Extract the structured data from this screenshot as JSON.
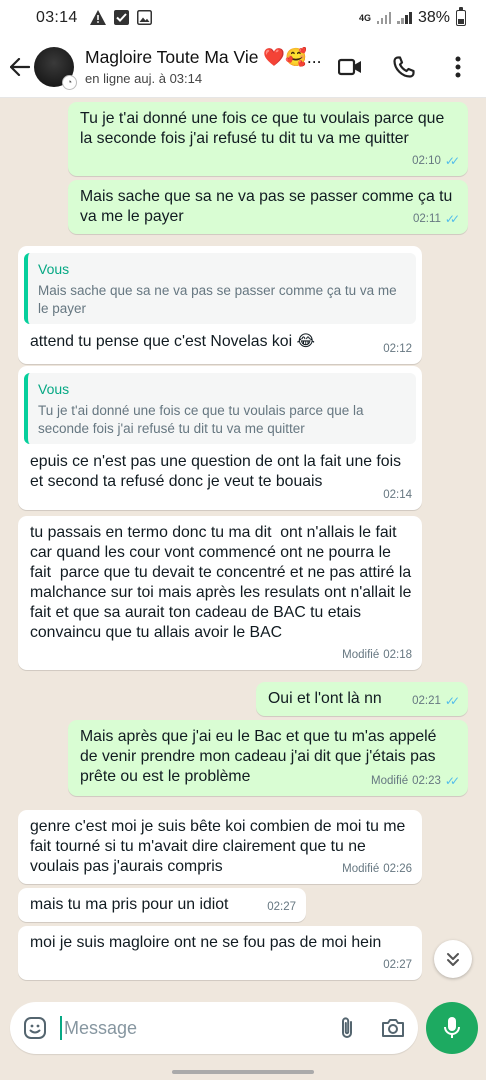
{
  "status_bar": {
    "time": "03:14",
    "network": "4G",
    "battery": "38%",
    "notif_icons": [
      "warning-icon",
      "checkbox-icon",
      "image-icon"
    ]
  },
  "header": {
    "contact_name": "Magloire Toute Ma Vie ❤️🥰...",
    "contact_status": "en ligne auj. à 03:14",
    "icons": [
      "back-arrow-icon",
      "video-call-icon",
      "phone-call-icon",
      "more-vert-icon"
    ]
  },
  "messages": [
    {
      "dir": "out",
      "text": "Tu je t'ai donné une fois ce que tu voulais parce que la seconde fois j'ai refusé tu dit tu va me quitter",
      "time": "02:10",
      "read": true
    },
    {
      "dir": "out",
      "text": "Mais sache que sa ne va pas se passer comme ça tu va me le payer",
      "time": "02:11",
      "read": true
    },
    {
      "dir": "in",
      "quote_author": "Vous",
      "quote_text": "Mais sache que sa ne va pas se passer comme ça tu va me le payer",
      "text": "attend tu pense que c'est Novelas koi 😂",
      "time": "02:12"
    },
    {
      "dir": "in",
      "quote_author": "Vous",
      "quote_text": "Tu je t'ai donné une fois ce que tu voulais parce que la seconde fois j'ai refusé tu dit tu va me quitter",
      "text": "epuis ce n'est pas une question de ont la fait une fois et second ta refusé donc je veut te bouais",
      "time": "02:14"
    },
    {
      "dir": "in",
      "text": "tu passais en termo donc tu ma dit  ont n'allais le fait car quand les cour vont commencé ont ne pourra le fait  parce que tu devait te concentré et ne pas attiré la malchance sur toi mais après les resulats ont n'allait le fait et que sa aurait ton cadeau de BAC tu etais convaincu que tu allais avoir le BAC",
      "time": "02:18",
      "edited": "Modifié"
    },
    {
      "dir": "out",
      "text": "Oui et l'ont là nn",
      "time": "02:21",
      "read": true
    },
    {
      "dir": "out",
      "text": "Mais après que j'ai eu le Bac et que tu m'as appelé de venir prendre mon cadeau j'ai dit que j'étais pas prête ou est le problème",
      "time": "02:23",
      "edited": "Modifié",
      "read": true
    },
    {
      "dir": "in",
      "text": "genre c'est moi je suis bête koi combien de moi tu me fait tourné si tu m'avait dire clairement que tu ne voulais pas j'aurais compris",
      "time": "02:26",
      "edited": "Modifié"
    },
    {
      "dir": "in",
      "text": "mais tu ma pris pour un idiot",
      "time": "02:27"
    },
    {
      "dir": "in",
      "text": "moi je suis magloire ont ne se fou pas de moi hein",
      "time": "02:27"
    }
  ],
  "composer": {
    "placeholder": "Message",
    "icons": [
      "emoji-sticker-icon",
      "attach-icon",
      "camera-icon",
      "mic-icon"
    ]
  }
}
